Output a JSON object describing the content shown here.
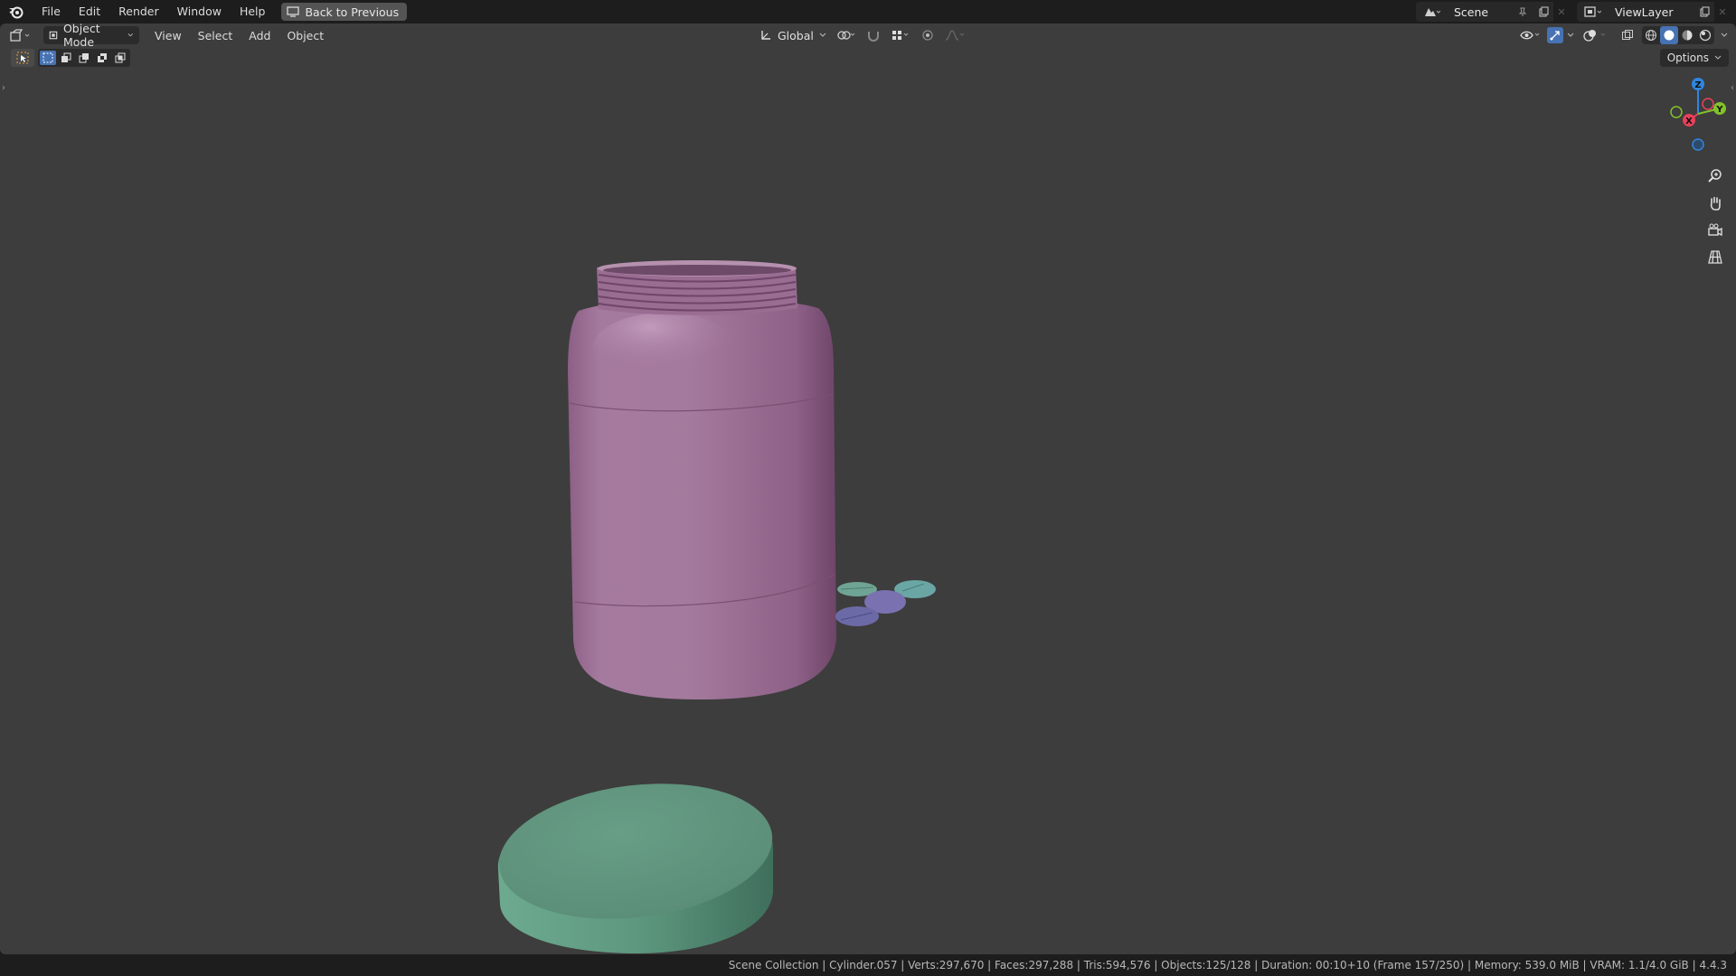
{
  "app": {
    "menu": [
      "File",
      "Edit",
      "Render",
      "Window",
      "Help"
    ],
    "back_button": "Back to Previous",
    "scene_name": "Scene",
    "view_layer": "ViewLayer"
  },
  "viewport_header": {
    "mode": "Object Mode",
    "menus": [
      "View",
      "Select",
      "Add",
      "Object"
    ],
    "orientation": "Global",
    "options": "Options"
  },
  "gizmo": {
    "axes": [
      "X",
      "Y",
      "Z"
    ],
    "colors": {
      "x": "#e8405a",
      "y": "#83c22a",
      "z": "#2f86e0"
    }
  },
  "scene_objects": {
    "jar_color": "#9d6e95",
    "lid_color": "#5e9a82",
    "pills": [
      "green",
      "teal",
      "purple",
      "purple"
    ]
  },
  "status": {
    "text": "Scene Collection | Cylinder.057 | Verts:297,670 | Faces:297,288 | Tris:594,576 | Objects:125/128 | Duration: 00:10+10 (Frame 157/250) | Memory: 539.0 MiB | VRAM: 1.1/4.0 GiB | 4.4.3"
  }
}
